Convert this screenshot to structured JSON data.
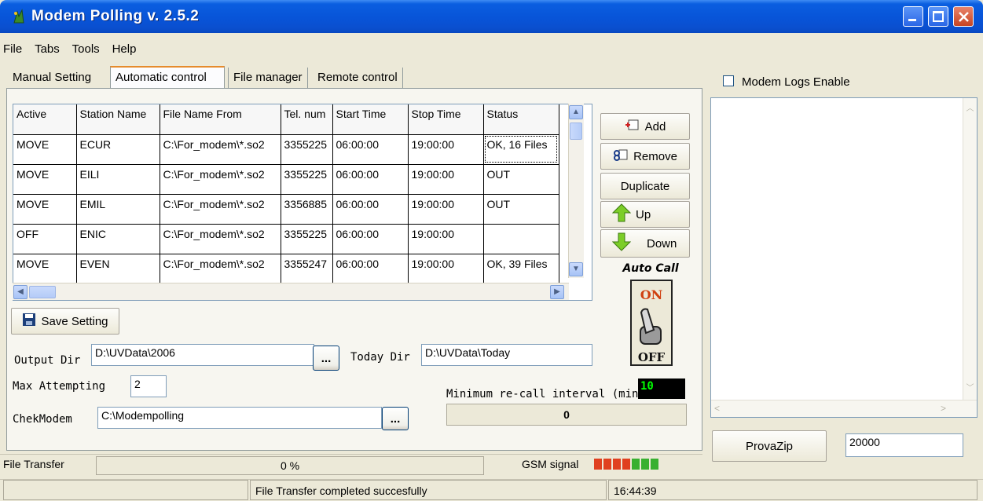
{
  "window": {
    "title": "Modem Polling v. 2.5.2"
  },
  "menu": [
    "File",
    "Tabs",
    "Tools",
    "Help"
  ],
  "tabs": [
    {
      "label": "Manual Setting",
      "active": false
    },
    {
      "label": "Automatic control",
      "active": true
    },
    {
      "label": "File manager",
      "active": false
    },
    {
      "label": "Remote control",
      "active": false
    }
  ],
  "grid": {
    "columns": [
      "Active",
      "Station Name",
      "File Name From",
      "Tel. num",
      "Start Time",
      "Stop Time",
      "Status"
    ],
    "rows": [
      [
        "MOVE",
        "ECUR",
        "C:\\For_modem\\*.so2",
        "3355225",
        "06:00:00",
        "19:00:00",
        "OK, 16 Files"
      ],
      [
        "MOVE",
        "EILI",
        "C:\\For_modem\\*.so2",
        "3355225",
        "06:00:00",
        "19:00:00",
        "OUT"
      ],
      [
        "MOVE",
        "EMIL",
        "C:\\For_modem\\*.so2",
        "3356885",
        "06:00:00",
        "19:00:00",
        "OUT"
      ],
      [
        "OFF",
        "ENIC",
        "C:\\For_modem\\*.so2",
        "3355225",
        "06:00:00",
        "19:00:00",
        ""
      ],
      [
        "MOVE",
        "EVEN",
        "C:\\For_modem\\*.so2",
        "3355247",
        "06:00:00",
        "19:00:00",
        "OK, 39 Files"
      ]
    ]
  },
  "buttons": {
    "add": "Add",
    "remove": "Remove",
    "duplicate": "Duplicate",
    "up": "Up",
    "down": "Down",
    "save": "Save Setting",
    "browse": "...",
    "provazip": "ProvaZip"
  },
  "autocall": {
    "label": "Auto Call",
    "on": "ON",
    "off": "OFF"
  },
  "settings": {
    "output_dir_label": "Output Dir",
    "output_dir_value": "D:\\UVData\\2006",
    "today_dir_label": "Today Dir",
    "today_dir_value": "D:\\UVData\\Today",
    "max_attempting_label": "Max Attempting",
    "max_attempting_value": "2",
    "min_recall_label": "Minimum re-call interval (min)",
    "min_recall_value": "10",
    "recall_counter": "0",
    "chekmodem_label": "ChekModem",
    "chekmodem_value": "C:\\Modempolling"
  },
  "logs": {
    "enable_label": "Modem Logs Enable",
    "checked": false
  },
  "provazip_value": "20000",
  "status": {
    "file_transfer_label": "File Transfer",
    "file_transfer_progress": "0 %",
    "gsm_label": "GSM signal",
    "gsm_levels": [
      "#e04020",
      "#e04020",
      "#e04020",
      "#e04020",
      "#38b030",
      "#38b030",
      "#38b030"
    ],
    "message": "File Transfer completed succesfully",
    "time": "16:44:39"
  },
  "colors": {
    "titlebar": "#0a5ee0",
    "face": "#ece9d8",
    "accent_tab": "#e68b2c"
  }
}
